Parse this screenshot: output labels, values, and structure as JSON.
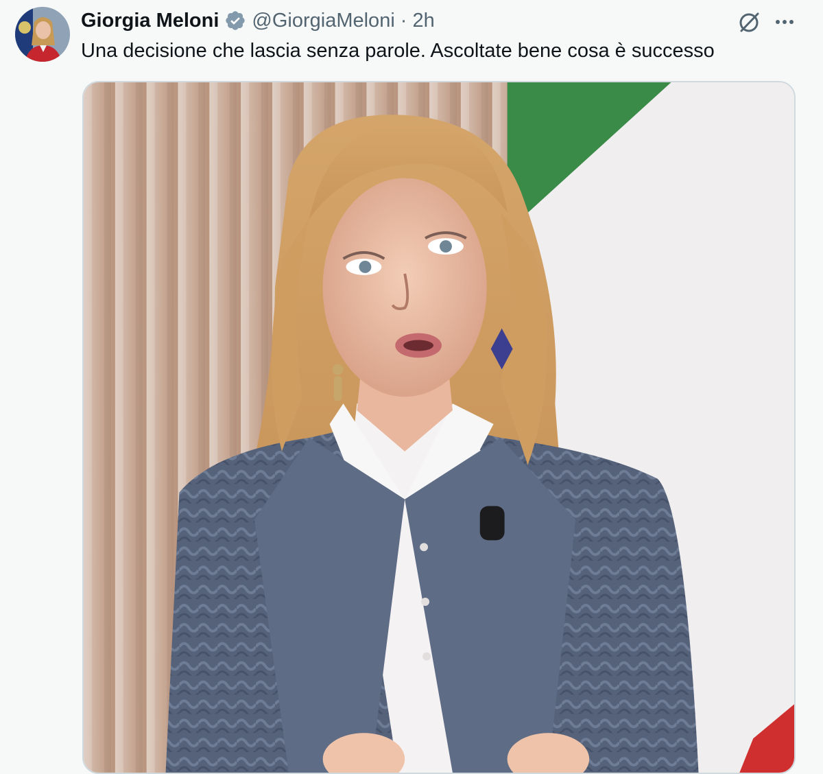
{
  "post": {
    "author": {
      "display_name": "Giorgia Meloni",
      "handle": "@GiorgiaMeloni",
      "verified": true,
      "avatar_icon": "avatar-photo"
    },
    "separator": "·",
    "timestamp": "2h",
    "text": "Una decisione che lascia senza parole. Ascoltate bene cosa è successo",
    "actions": {
      "grok_icon": "grok-icon",
      "more_icon": "more-dots-icon"
    },
    "media": {
      "type": "video-still",
      "description_icon": "video-frame"
    }
  },
  "colors": {
    "background": "#f7f9f9",
    "text_primary": "#0f1419",
    "text_secondary": "#536471",
    "verified_badge": "#829aab",
    "flag_green": "#3a8a48",
    "flag_white": "#f1eef0",
    "flag_red": "#d02f2f"
  }
}
